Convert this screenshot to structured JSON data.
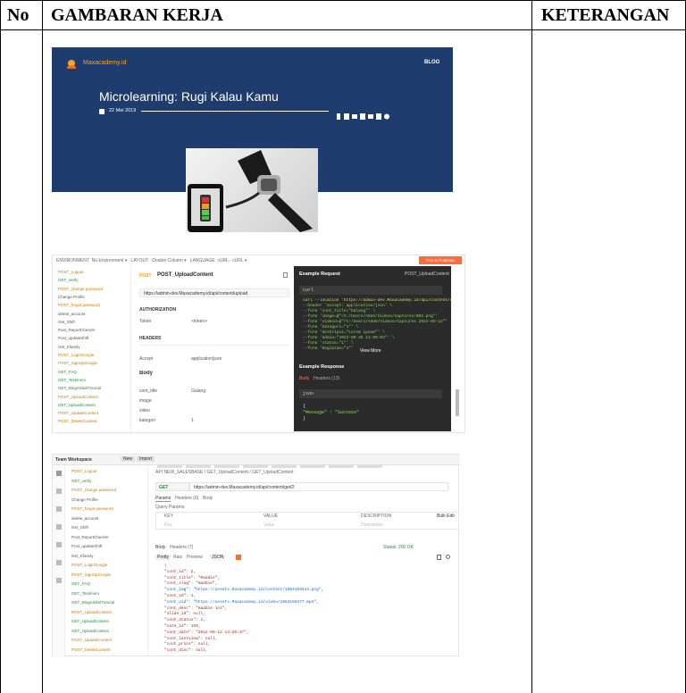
{
  "table": {
    "headers": {
      "no": "No",
      "gambaran": "GAMBARAN KERJA",
      "keterangan": "KETERANGAN"
    }
  },
  "blog": {
    "brand": "Maxacademy.id",
    "nav_label": "BLOG",
    "title": "Microlearning: Rugi Kalau Kamu",
    "date": "22 Mei 2019",
    "colors": {
      "banner": "#1f3c6e",
      "accent": "#f5a623"
    }
  },
  "postman1": {
    "method": "POST",
    "request_name": "POST_UploadContent",
    "url": "https://admin-dev.Maxacademy.id/api/content/upload",
    "sections": {
      "authorization": "AUTHORIZATION",
      "headers": "HEADERS",
      "body": "Body"
    },
    "auth_rows": [
      {
        "key": "Token",
        "value": "<token>"
      }
    ],
    "header_rows": [
      {
        "key": "Accept",
        "value": "application/json"
      }
    ],
    "body_rows": [
      {
        "key": "cont_title",
        "value": "Galang"
      },
      {
        "key": "image",
        "value": ""
      },
      {
        "key": "video",
        "value": ""
      },
      {
        "key": "kategori",
        "value": "1"
      }
    ],
    "sidebar_items": [
      "POST_Logout",
      "GET_verify",
      "POST_change password",
      "Change Profile",
      "POST_forgot password",
      "delete_account",
      "Get_Shift",
      "Post_ReportCheckIn",
      "Post_updateShift",
      "Get_Kfamily",
      "POST_LoginGoogle",
      "POST_SignUpGoogle",
      "GET_FAQ",
      "GET_Testimoni",
      "GET_BlogArtikelTutorial",
      "POST_UploadContent",
      "GET_UploadContent",
      "POST_UpdateContent",
      "POST_DeleteContent"
    ],
    "example_request_title": "Example Request",
    "example_request_name": "POST_UploadContent",
    "lang_label": "curl",
    "code_lines": [
      "curl --location 'https://admin-dev.Maxacademy.id/api/content/upload'",
      "--header 'accept: application/json' \\",
      "--form 'cont_title=\"Galang\"' \\",
      "--form 'image=@\"/C:/Users/ASUS/Videos/Captures/002.png\"'",
      "--form 'videod=@\"/C:/Users/ASUS/Videos/Captures 2022-09-24\"'",
      "--form 'kategori=\"1\"' \\",
      "--form 'deskripsi=\"Lorem ipsum\"' \\",
      "--form 'admin=\"2022-09-26 11:09:03\"' \\",
      "--form 'status=\"1\"' \\",
      "--form 'Kegiatan=\"1\"'"
    ],
    "view_more": "View More",
    "example_response_title": "Example Response",
    "response_tabs": [
      "Body",
      "Headers (13)"
    ],
    "response_lang": "json",
    "response_lines": [
      "{",
      "  \"Message\" : \"Success\"",
      "}"
    ],
    "run_button": "Run in Postman",
    "colors": {
      "dark": "#2b2b2b",
      "orange": "#ff6c37",
      "green": "#8fd16a"
    }
  },
  "postman2": {
    "workspace": "Team Workspace",
    "new_label": "New",
    "import_label": "Import",
    "breadcrumb": "API NEW_SALESBASE / GET_UploadContent / GET_UploadContent",
    "method": "GET",
    "url": "https://admin-dev.Maxacademy.id/api/content/get/2",
    "tabs": [
      "Params",
      "Headers (6)",
      "Body"
    ],
    "query_params": "Query Params",
    "param_headers": [
      "KEY",
      "VALUE",
      "DESCRIPTION"
    ],
    "param_placeholders": [
      "Key",
      "Value",
      "Description"
    ],
    "bulk_edit": "Bulk Edit",
    "response_tabs": [
      "Body",
      "Headers (7)"
    ],
    "status_label": "Status: 200 OK",
    "view_tabs": [
      "Pretty",
      "Raw",
      "Preview",
      "JSON"
    ],
    "sidebar_items": [
      "POST_Logout",
      "GET_verify",
      "POST_change password",
      "Change Profile",
      "POST_forgot password",
      "delete_account",
      "Get_Shift",
      "Post_ReportCheckIn",
      "Post_updateShift",
      "Get_Kfamily",
      "POST_LoginGoogle",
      "POST_SignUpGoogle",
      "GET_FAQ",
      "GET_Testimoni",
      "GET_BlogArtikelTutorial",
      "POST_UploadContent",
      "GET_UploadContent",
      "GET_UploadContent",
      "POST_UpdateContent",
      "POST_DeleteContent"
    ],
    "code_lines": [
      "{",
      "  \"cont_id\": 2,",
      "  \"cont_title\": \"Maddie\",",
      "  \"cont_slug\": \"maddie\",",
      "  \"cont_img\": \"https://assets.Maxacademy.id/content/1664159444.png\",",
      "  \"cont_vd\": 1,",
      "  \"cont_vid\": \"https://assets.Maxacademy.id/video/1664159477.mp4\",",
      "  \"cont_desc\": \"maddie ini\",",
      "  \"slide_id\": null,",
      "  \"cont_status\": 1,",
      "  \"cate_id\": 159,",
      "  \"cont_date\": \"2022-09-12 14:20:47\",",
      "  \"cont_lastview\": null,",
      "  \"cont_price\": null,",
      "  \"cont_disc\": null,"
    ]
  }
}
